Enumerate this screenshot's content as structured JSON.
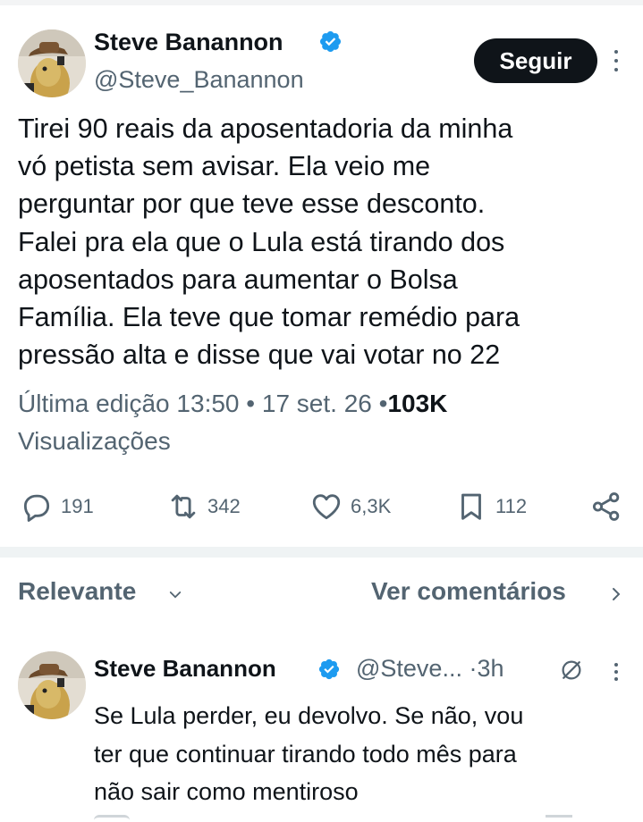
{
  "post": {
    "author_name": "Steve Banannon",
    "author_handle": "@Steve_Banannon",
    "follow_label": "Seguir",
    "text_lines": [
      "Tirei 90 reais da aposentadoria da minha",
      "vó petista sem avisar. Ela veio me",
      "perguntar por que teve esse desconto.",
      "Falei pra ela que o Lula está tirando dos",
      "aposentados para aumentar o Bolsa",
      "Família. Ela teve que tomar remédio para",
      "pressão alta e disse que vai votar no 22"
    ],
    "edited_label": "Última edição",
    "time": "13:50",
    "separator": "•",
    "date": "17 set. 26",
    "views_count": "103K",
    "views_label": "Visualizações",
    "stats": {
      "replies": "191",
      "reposts": "342",
      "likes": "6,3K",
      "bookmarks": "112"
    }
  },
  "replies_header": {
    "sort_label": "Relevante",
    "view_comments_label": "Ver comentários"
  },
  "reply": {
    "author_name": "Steve Banannon",
    "handle_time": "@Steve... ·3h",
    "text_lines": [
      "Se Lula perder, eu devolvo. Se não, vou",
      "ter que continuar tirando todo mês para",
      "não sair como mentiroso"
    ]
  },
  "colors": {
    "primary_text": "#0f1419",
    "secondary_text": "#536471",
    "verified_blue": "#1d9bf0",
    "divider": "#eff3f4"
  },
  "icons": {
    "reply": "speech-bubble-icon",
    "repost": "repost-arrows-icon",
    "like": "heart-icon",
    "bookmark": "bookmark-icon",
    "share": "share-nodes-icon",
    "verified": "verified-badge-icon",
    "grok": "grok-slash-circle-icon"
  }
}
